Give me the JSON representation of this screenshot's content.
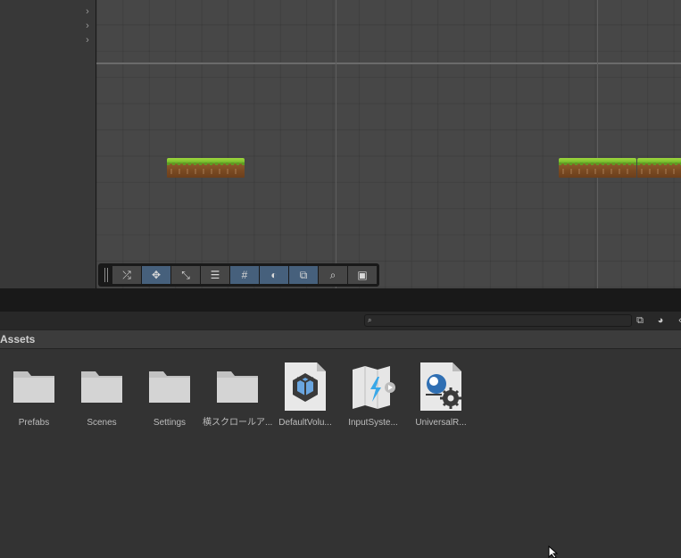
{
  "toolbar": {
    "tools": [
      {
        "name": "shuffle-icon",
        "glyph": "⤮",
        "active": false
      },
      {
        "name": "move-tool-icon",
        "glyph": "✥",
        "active": true
      },
      {
        "name": "rect-tool-icon",
        "glyph": "⤡",
        "active": false
      },
      {
        "name": "sliders-icon",
        "glyph": "☰",
        "active": false
      },
      {
        "name": "grid-snap-icon",
        "glyph": "#",
        "active": true
      },
      {
        "name": "lighting-icon",
        "glyph": "◐",
        "active": true
      },
      {
        "name": "layers-icon",
        "glyph": "⧉",
        "active": true
      },
      {
        "name": "zoom-icon",
        "glyph": "⌕",
        "active": false
      },
      {
        "name": "camera-icon",
        "glyph": "▣",
        "active": false
      }
    ]
  },
  "project": {
    "search_value": "",
    "breadcrumb": "Assets",
    "assets": [
      {
        "label": "Prefabs",
        "kind": "folder"
      },
      {
        "label": "Scenes",
        "kind": "folder"
      },
      {
        "label": "Settings",
        "kind": "folder"
      },
      {
        "label": "横スクロールア...",
        "kind": "folder"
      },
      {
        "label": "DefaultVolu...",
        "kind": "volume-profile"
      },
      {
        "label": "InputSyste...",
        "kind": "input-actions"
      },
      {
        "label": "UniversalR...",
        "kind": "render-pipeline"
      }
    ]
  },
  "colors": {
    "scene_bg": "#474747",
    "active_tool": "#46607c",
    "panel_bg": "#333333",
    "grass": "#7ec230",
    "dirt": "#7a4a22"
  }
}
